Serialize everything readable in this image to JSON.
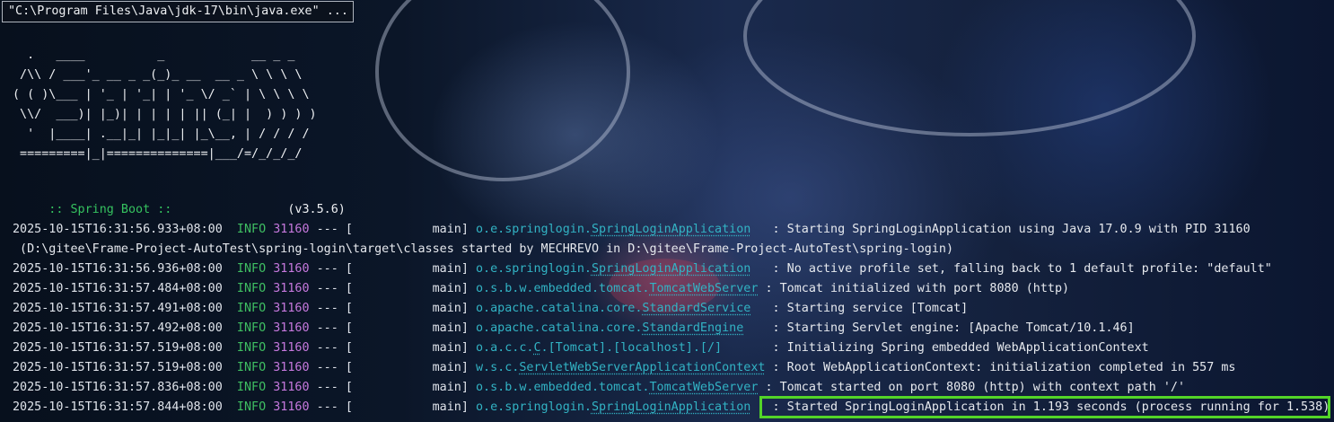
{
  "window": {
    "title": "\"C:\\Program Files\\Java\\jdk-17\\bin\\java.exe\" ..."
  },
  "banner": [
    "  .   ____          _            __ _ _",
    " /\\\\ / ___'_ __ _ _(_)_ __  __ _ \\ \\ \\ \\",
    "( ( )\\___ | '_ | '_| | '_ \\/ _` | \\ \\ \\ \\",
    " \\\\/  ___)| |_)| | | | | || (_| |  ) ) ) )",
    "  '  |____| .__|_| |_|_| |_\\__, | / / / /",
    " =========|_|==============|___/=/_/_/_/"
  ],
  "spring_boot": {
    "label": " :: Spring Boot ::",
    "version": "(v3.5.6)"
  },
  "log_lines": [
    {
      "ts": "2025-10-15T16:31:56.933+08:00",
      "level": "INFO",
      "pid": "31160",
      "sep": "--- [",
      "thread": "           main]",
      "logger_pkg": "o.e.springlogin.",
      "logger_cls": "SpringLoginApplication",
      "pad": "   ",
      "msg": ": Starting SpringLoginApplication using Java 17.0.9 with PID 31160"
    },
    {
      "ts": "2025-10-15T16:31:56.936+08:00",
      "level": "INFO",
      "pid": "31160",
      "sep": "--- [",
      "thread": "           main]",
      "logger_pkg": "o.e.springlogin.",
      "logger_cls": "SpringLoginApplication",
      "pad": "   ",
      "msg": ": No active profile set, falling back to 1 default profile: \"default\""
    },
    {
      "ts": "2025-10-15T16:31:57.484+08:00",
      "level": "INFO",
      "pid": "31160",
      "sep": "--- [",
      "thread": "           main]",
      "logger_pkg": "o.s.b.w.embedded.tomcat.",
      "logger_cls": "TomcatWebServer",
      "pad": " ",
      "msg": ": Tomcat initialized with port 8080 (http)"
    },
    {
      "ts": "2025-10-15T16:31:57.491+08:00",
      "level": "INFO",
      "pid": "31160",
      "sep": "--- [",
      "thread": "           main]",
      "logger_pkg": "o.apache.catalina.core.",
      "logger_cls": "StandardService",
      "pad": "   ",
      "msg": ": Starting service [Tomcat]"
    },
    {
      "ts": "2025-10-15T16:31:57.492+08:00",
      "level": "INFO",
      "pid": "31160",
      "sep": "--- [",
      "thread": "           main]",
      "logger_pkg": "o.apache.catalina.core.",
      "logger_cls": "StandardEngine",
      "pad": "    ",
      "msg": ": Starting Servlet engine: [Apache Tomcat/10.1.46]"
    },
    {
      "ts": "2025-10-15T16:31:57.519+08:00",
      "level": "INFO",
      "pid": "31160",
      "sep": "--- [",
      "thread": "           main]",
      "logger_pkg": "o.a.c.c.",
      "logger_cls": "C",
      "logger_tail": ".[Tomcat].[localhost].[/]",
      "pad": "       ",
      "msg": ": Initializing Spring embedded WebApplicationContext"
    },
    {
      "ts": "2025-10-15T16:31:57.519+08:00",
      "level": "INFO",
      "pid": "31160",
      "sep": "--- [",
      "thread": "           main]",
      "logger_pkg": "w.s.c.",
      "logger_cls": "ServletWebServerApplicationContext",
      "pad": " ",
      "msg": ": Root WebApplicationContext: initialization completed in 557 ms"
    },
    {
      "ts": "2025-10-15T16:31:57.836+08:00",
      "level": "INFO",
      "pid": "31160",
      "sep": "--- [",
      "thread": "           main]",
      "logger_pkg": "o.s.b.w.embedded.tomcat.",
      "logger_cls": "TomcatWebServer",
      "pad": " ",
      "msg": ": Tomcat started on port 8080 (http) with context path '/'"
    },
    {
      "ts": "2025-10-15T16:31:57.844+08:00",
      "level": "INFO",
      "pid": "31160",
      "sep": "--- [",
      "thread": "           main]",
      "logger_pkg": "o.e.springlogin.",
      "logger_cls": "SpringLoginApplication",
      "pad": "   ",
      "msg": ": Started SpringLoginApplication in 1.193 seconds (process running for 1.538)"
    }
  ],
  "continuation": " (D:\\gitee\\Frame-Project-AutoTest\\spring-login\\target\\classes started by MECHREVO in D:\\gitee\\Frame-Project-AutoTest\\spring-login)",
  "colors": {
    "info": "#3fbf62",
    "pid": "#c678dd",
    "logger": "#32b3c4",
    "highlight_box": "#53d428"
  }
}
